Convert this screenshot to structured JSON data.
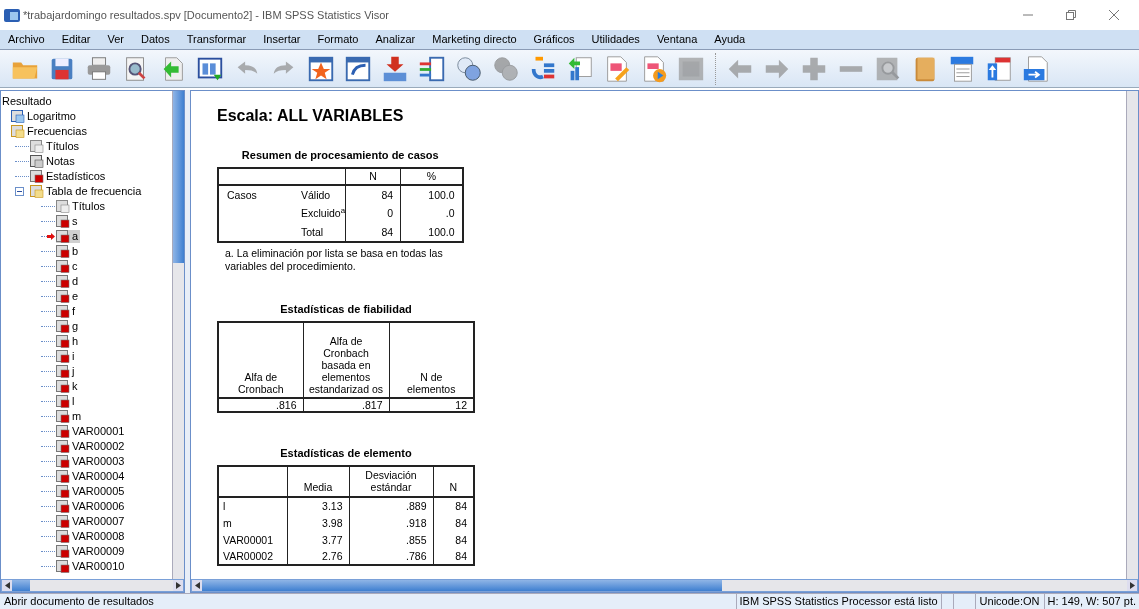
{
  "window": {
    "title": "*trabajardomingo resultados.spv [Documento2] - IBM SPSS Statistics Visor"
  },
  "menu": [
    "Archivo",
    "Editar",
    "Ver",
    "Datos",
    "Transformar",
    "Insertar",
    "Formato",
    "Analizar",
    "Marketing directo",
    "Gráficos",
    "Utilidades",
    "Ventana",
    "Ayuda"
  ],
  "toolbar": [
    {
      "kind": "open",
      "disabled": false
    },
    {
      "kind": "save",
      "disabled": false
    },
    {
      "kind": "print",
      "disabled": false
    },
    {
      "kind": "preview",
      "disabled": false
    },
    {
      "kind": "export",
      "disabled": false
    },
    {
      "kind": "data",
      "disabled": false
    },
    {
      "kind": "undo",
      "disabled": true
    },
    {
      "kind": "redo",
      "disabled": true
    },
    {
      "kind": "star",
      "disabled": false
    },
    {
      "kind": "pivot",
      "disabled": false
    },
    {
      "kind": "insert",
      "disabled": false
    },
    {
      "kind": "vars",
      "disabled": false
    },
    {
      "kind": "circles",
      "disabled": false
    },
    {
      "kind": "circles",
      "disabled": true
    },
    {
      "kind": "tree",
      "disabled": false
    },
    {
      "kind": "chart",
      "disabled": false
    },
    {
      "kind": "edit",
      "disabled": false
    },
    {
      "kind": "run",
      "disabled": false
    },
    {
      "kind": "square",
      "disabled": true
    },
    {
      "kind": "back",
      "disabled": true
    },
    {
      "kind": "forward",
      "disabled": true
    },
    {
      "kind": "plus",
      "disabled": true
    },
    {
      "kind": "minus",
      "disabled": true
    },
    {
      "kind": "zoom",
      "disabled": true
    },
    {
      "kind": "book",
      "disabled": false
    },
    {
      "kind": "panel",
      "disabled": false
    },
    {
      "kind": "docup",
      "disabled": false
    },
    {
      "kind": "docarrow",
      "disabled": false
    }
  ],
  "outline": {
    "items": [
      {
        "label": "Resultado",
        "selected": false,
        "children": [
          {
            "label": "Logaritmo",
            "kind": "log",
            "selected": false
          },
          {
            "label": "Frecuencias",
            "kind": "proc",
            "selected": false,
            "children": [
              {
                "label": "Títulos",
                "kind": "title",
                "selected": false
              },
              {
                "label": "Notas",
                "kind": "notes",
                "selected": false
              },
              {
                "label": "Estadísticos",
                "kind": "table",
                "selected": false
              },
              {
                "label": "Tabla de frecuencia",
                "kind": "proc",
                "selected": false,
                "expanded": true,
                "children": [
                  {
                    "label": "Títulos",
                    "kind": "title",
                    "selected": false
                  },
                  {
                    "label": "s",
                    "kind": "table",
                    "selected": false
                  },
                  {
                    "label": "a",
                    "kind": "table",
                    "selected": true
                  },
                  {
                    "label": "b",
                    "kind": "table",
                    "selected": false
                  },
                  {
                    "label": "c",
                    "kind": "table",
                    "selected": false
                  },
                  {
                    "label": "d",
                    "kind": "table",
                    "selected": false
                  },
                  {
                    "label": "e",
                    "kind": "table",
                    "selected": false
                  },
                  {
                    "label": "f",
                    "kind": "table",
                    "selected": false
                  },
                  {
                    "label": "g",
                    "kind": "table",
                    "selected": false
                  },
                  {
                    "label": "h",
                    "kind": "table",
                    "selected": false
                  },
                  {
                    "label": "i",
                    "kind": "table",
                    "selected": false
                  },
                  {
                    "label": "j",
                    "kind": "table",
                    "selected": false
                  },
                  {
                    "label": "k",
                    "kind": "table",
                    "selected": false
                  },
                  {
                    "label": "l",
                    "kind": "table",
                    "selected": false
                  },
                  {
                    "label": "m",
                    "kind": "table",
                    "selected": false
                  },
                  {
                    "label": "VAR00001",
                    "kind": "table",
                    "selected": false
                  },
                  {
                    "label": "VAR00002",
                    "kind": "table",
                    "selected": false
                  },
                  {
                    "label": "VAR00003",
                    "kind": "table",
                    "selected": false
                  },
                  {
                    "label": "VAR00004",
                    "kind": "table",
                    "selected": false
                  },
                  {
                    "label": "VAR00005",
                    "kind": "table",
                    "selected": false
                  },
                  {
                    "label": "VAR00006",
                    "kind": "table",
                    "selected": false
                  },
                  {
                    "label": "VAR00007",
                    "kind": "table",
                    "selected": false
                  },
                  {
                    "label": "VAR00008",
                    "kind": "table",
                    "selected": false
                  },
                  {
                    "label": "VAR00009",
                    "kind": "table",
                    "selected": false
                  },
                  {
                    "label": "VAR00010",
                    "kind": "table",
                    "selected": false
                  }
                ]
              }
            ]
          }
        ]
      }
    ]
  },
  "output": {
    "heading": "Escala: ALL VARIABLES",
    "tables": [
      {
        "title": "Resumen de procesamiento de casos",
        "header": [
          "N",
          "%"
        ],
        "rows": [
          [
            "Casos",
            "Válido",
            "84",
            "100.0"
          ],
          [
            "",
            "Excluido$^{a}$",
            "0",
            ".0"
          ],
          [
            "",
            "Total",
            "84",
            "100.0"
          ]
        ],
        "footnote": "a. La eliminación por lista se basa en todas las variables del procedimiento."
      },
      {
        "title": "Estadísticas de fiabilidad",
        "header": [
          "Alfa de Cronbach",
          "Alfa de Cronbach basada en elementos estandarizad os",
          "N de elementos"
        ],
        "rows": [
          [
            ".816",
            ".817",
            "12"
          ]
        ]
      },
      {
        "title": "Estadísticas de elemento",
        "header": [
          "Media",
          "Desviación estándar",
          "N"
        ],
        "rows": [
          [
            "l",
            "3.13",
            ".889",
            "84"
          ],
          [
            "m",
            "3.98",
            ".918",
            "84"
          ],
          [
            "VAR00001",
            "3.77",
            ".855",
            "84"
          ],
          [
            "VAR00002",
            "2.76",
            ".786",
            "84"
          ]
        ]
      }
    ]
  },
  "status_bar": {
    "message": "Abrir documento de resultados",
    "processor": "IBM SPSS Statistics Processor está listo",
    "unicode": "Unicode:ON",
    "dimensions": "H: 149, W: 507 pt."
  }
}
